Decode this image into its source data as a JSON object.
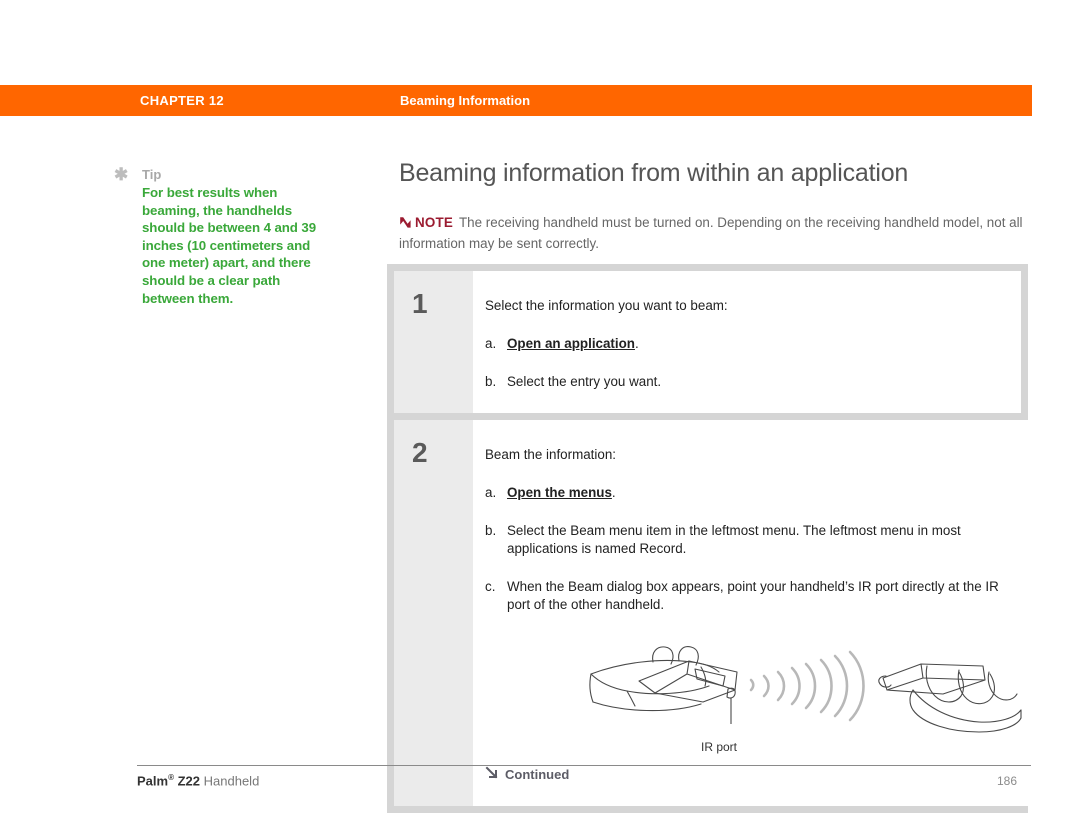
{
  "header": {
    "chapter_label": "CHAPTER 12",
    "topic": "Beaming Information",
    "bar_color": "#ff6600"
  },
  "tip": {
    "icon": "asterisk-icon",
    "title": "Tip",
    "body": "For best results when beaming, the handhelds should be between 4 and 39 inches (10 centimeters and one meter) apart, and there should be a clear path between them.",
    "text_color": "#3aa83a"
  },
  "main": {
    "heading": "Beaming information from within an application",
    "note": {
      "icon": "note-arrow-icon",
      "label": "NOTE",
      "label_color": "#9b1b30",
      "text": "The receiving handheld must be turned on. Depending on the receiving handheld model, not all information may be sent correctly."
    },
    "steps": [
      {
        "number": "1",
        "lead": "Select the information you want to beam:",
        "substeps": [
          {
            "marker": "a.",
            "action": "Open an application",
            "tail": "."
          },
          {
            "marker": "b.",
            "action": "",
            "tail": "Select the entry you want."
          }
        ]
      },
      {
        "number": "2",
        "lead": "Beam the information:",
        "substeps": [
          {
            "marker": "a.",
            "action": "Open the menus",
            "tail": "."
          },
          {
            "marker": "b.",
            "action": "",
            "tail": "Select the Beam menu item in the leftmost menu. The leftmost menu in most applications is named Record."
          },
          {
            "marker": "c.",
            "action": "",
            "tail": "When the Beam dialog box appears, point your handheld’s IR port directly at the IR port of the other handheld."
          }
        ],
        "illustration": {
          "caption": "IR port",
          "alt": "two hands holding handhelds beaming infrared between them"
        },
        "continued": {
          "icon": "arrow-down-right-icon",
          "label": "Continued"
        }
      }
    ]
  },
  "footer": {
    "brand": "Palm",
    "registered": "®",
    "model": "Z22",
    "product": "Handheld",
    "page_number": "186"
  }
}
